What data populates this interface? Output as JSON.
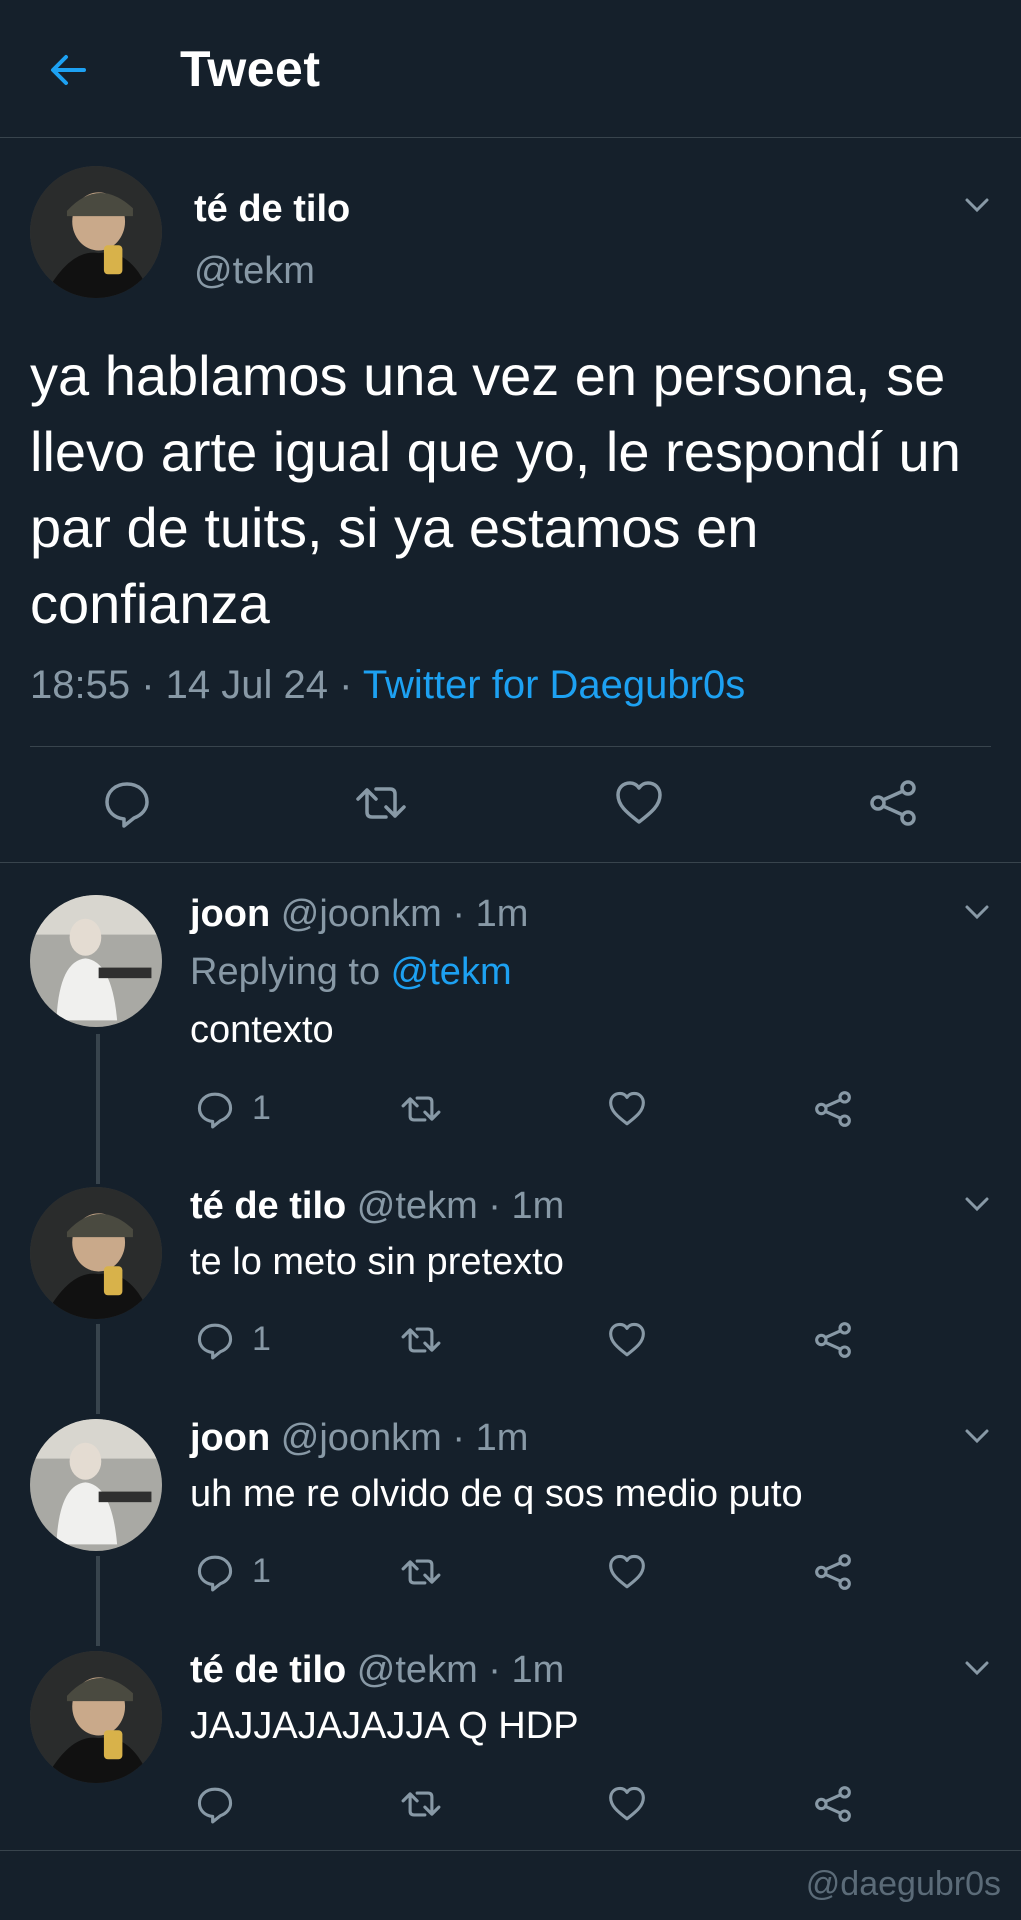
{
  "header": {
    "title": "Tweet"
  },
  "main_tweet": {
    "name": "té de tilo",
    "handle": "@tekm",
    "text": "ya hablamos una vez en persona, se llevo arte igual que yo, le respondí un par de tuits, si ya estamos en confianza",
    "time": "18:55 · 14 Jul 24 · ",
    "source": "Twitter for Daegubr0s"
  },
  "replies": [
    {
      "name": "joon",
      "handle": "@joonkm",
      "dot": " · ",
      "time": "1m",
      "replying_prefix": "Replying to ",
      "replying_to": "@tekm",
      "text": "contexto",
      "reply_count": "1"
    },
    {
      "name": "té de tilo",
      "handle": "@tekm",
      "dot": " · ",
      "time": "1m",
      "text": "te lo meto sin pretexto",
      "reply_count": "1"
    },
    {
      "name": "joon",
      "handle": "@joonkm",
      "dot": " · ",
      "time": "1m",
      "text": "uh me re olvido de q sos medio puto",
      "reply_count": "1"
    },
    {
      "name": "té de tilo",
      "handle": "@tekm",
      "dot": " · ",
      "time": "1m",
      "text": "JAJJAJAJAJJA Q HDP",
      "reply_count": ""
    }
  ],
  "watermark": "@daegubr0s",
  "colors": {
    "background": "#15202b",
    "accent": "#1da1f2",
    "secondary_text": "#8899a6",
    "divider": "#38444d"
  }
}
